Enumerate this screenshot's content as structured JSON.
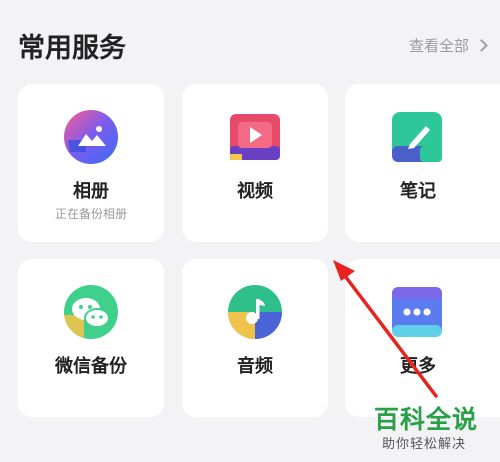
{
  "header": {
    "title": "常用服务",
    "view_all": "查看全部"
  },
  "services": [
    {
      "label": "相册",
      "sublabel": "正在备份相册",
      "icon": "album-icon"
    },
    {
      "label": "视频",
      "sublabel": "",
      "icon": "video-icon"
    },
    {
      "label": "笔记",
      "sublabel": "",
      "icon": "notes-icon"
    },
    {
      "label": "微信备份",
      "sublabel": "",
      "icon": "wechat-backup-icon"
    },
    {
      "label": "音频",
      "sublabel": "",
      "icon": "audio-icon"
    },
    {
      "label": "更多",
      "sublabel": "",
      "icon": "more-icon"
    }
  ],
  "watermark": {
    "title": "百科全说",
    "subtitle": "助你轻松解决"
  },
  "colors": {
    "background": "#f3f3f5",
    "card": "#ffffff",
    "annotation_arrow": "#e8231d",
    "watermark_green": "#27a046"
  }
}
